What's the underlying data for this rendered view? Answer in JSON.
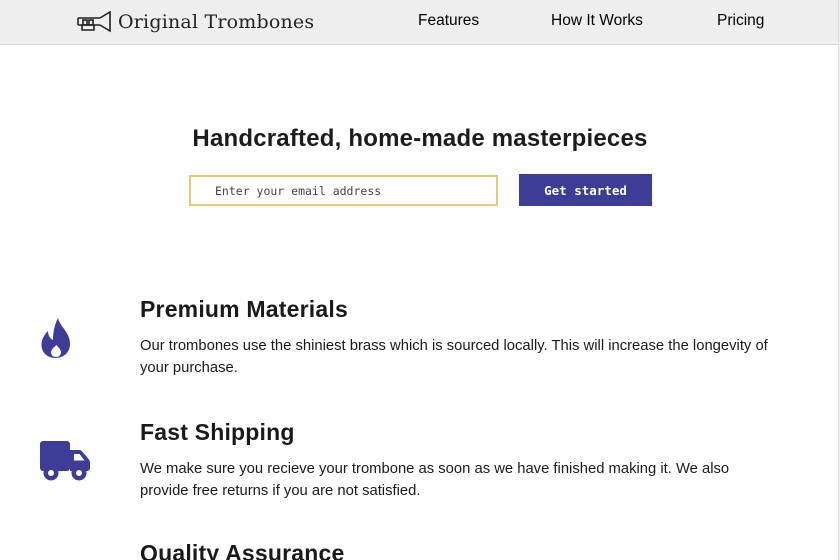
{
  "header": {
    "logo_text": "Original Trombones",
    "logo_icon": "trombone-icon",
    "nav": {
      "features": "Features",
      "how_it_works": "How It Works",
      "pricing": "Pricing"
    }
  },
  "hero": {
    "title": "Handcrafted, home-made masterpieces",
    "email_placeholder": "Enter your email address",
    "email_value": "",
    "cta_label": "Get started"
  },
  "features": [
    {
      "icon": "fire-icon",
      "title": "Premium Materials",
      "description": "Our trombones use the shiniest brass which is sourced locally. This will increase the longevity of your purchase."
    },
    {
      "icon": "truck-icon",
      "title": "Fast Shipping",
      "description": "We make sure you recieve your trombone as soon as we have finished making it. We also provide free returns if you are not satisfied."
    },
    {
      "icon": "",
      "title": "Quality Assurance",
      "description": ""
    }
  ],
  "colors": {
    "icon_blue": "#3d3d97",
    "header_bg": "#eeeeee",
    "cta_bg": "#3d3d97",
    "input_border": "#e8c97a"
  }
}
